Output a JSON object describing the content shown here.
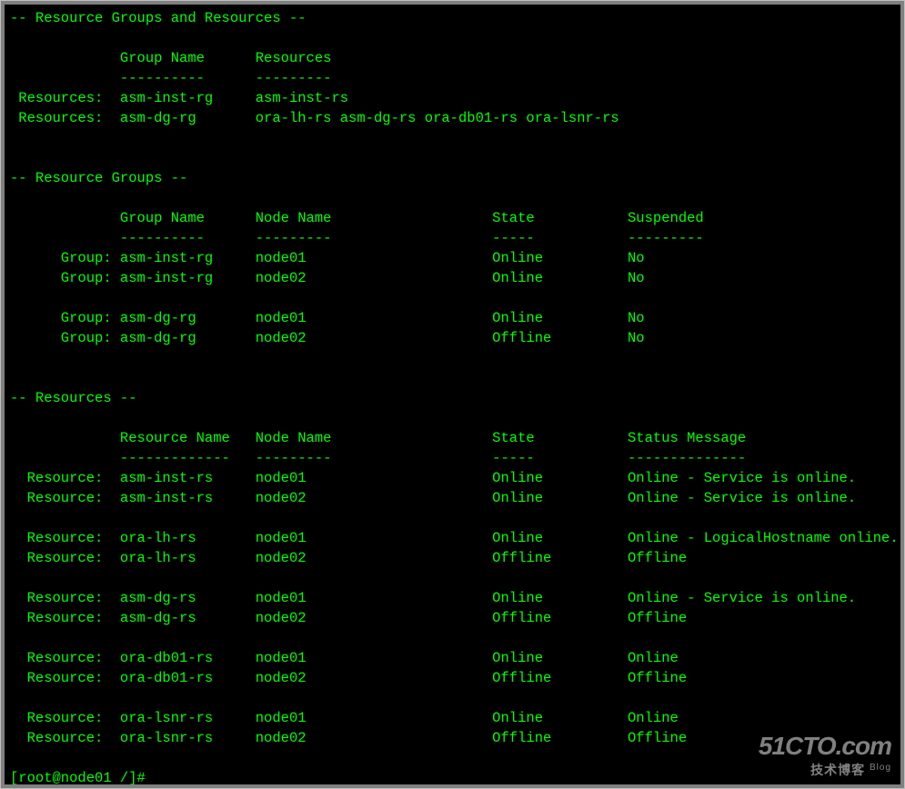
{
  "sections": {
    "rgr": {
      "title": "-- Resource Groups and Resources --",
      "headers": [
        "Group Name",
        "Resources"
      ],
      "rows": [
        {
          "label": "Resources:",
          "group": "asm-inst-rg",
          "resources": "asm-inst-rs"
        },
        {
          "label": "Resources:",
          "group": "asm-dg-rg",
          "resources": "ora-lh-rs asm-dg-rs ora-db01-rs ora-lsnr-rs"
        }
      ]
    },
    "rg": {
      "title": "-- Resource Groups --",
      "headers": [
        "Group Name",
        "Node Name",
        "State",
        "Suspended"
      ],
      "rows": [
        {
          "label": "Group:",
          "group": "asm-inst-rg",
          "node": "node01",
          "state": "Online",
          "suspended": "No"
        },
        {
          "label": "Group:",
          "group": "asm-inst-rg",
          "node": "node02",
          "state": "Online",
          "suspended": "No"
        },
        null,
        {
          "label": "Group:",
          "group": "asm-dg-rg",
          "node": "node01",
          "state": "Online",
          "suspended": "No"
        },
        {
          "label": "Group:",
          "group": "asm-dg-rg",
          "node": "node02",
          "state": "Offline",
          "suspended": "No"
        }
      ]
    },
    "res": {
      "title": "-- Resources --",
      "headers": [
        "Resource Name",
        "Node Name",
        "State",
        "Status Message"
      ],
      "rows": [
        {
          "label": "Resource:",
          "name": "asm-inst-rs",
          "node": "node01",
          "state": "Online",
          "msg": "Online - Service is online."
        },
        {
          "label": "Resource:",
          "name": "asm-inst-rs",
          "node": "node02",
          "state": "Online",
          "msg": "Online - Service is online."
        },
        null,
        {
          "label": "Resource:",
          "name": "ora-lh-rs",
          "node": "node01",
          "state": "Online",
          "msg": "Online - LogicalHostname online."
        },
        {
          "label": "Resource:",
          "name": "ora-lh-rs",
          "node": "node02",
          "state": "Offline",
          "msg": "Offline"
        },
        null,
        {
          "label": "Resource:",
          "name": "asm-dg-rs",
          "node": "node01",
          "state": "Online",
          "msg": "Online - Service is online."
        },
        {
          "label": "Resource:",
          "name": "asm-dg-rs",
          "node": "node02",
          "state": "Offline",
          "msg": "Offline"
        },
        null,
        {
          "label": "Resource:",
          "name": "ora-db01-rs",
          "node": "node01",
          "state": "Online",
          "msg": "Online"
        },
        {
          "label": "Resource:",
          "name": "ora-db01-rs",
          "node": "node02",
          "state": "Offline",
          "msg": "Offline"
        },
        null,
        {
          "label": "Resource:",
          "name": "ora-lsnr-rs",
          "node": "node01",
          "state": "Online",
          "msg": "Online"
        },
        {
          "label": "Resource:",
          "name": "ora-lsnr-rs",
          "node": "node02",
          "state": "Offline",
          "msg": "Offline"
        }
      ]
    }
  },
  "prompt": "[root@node01 /]#",
  "watermark": {
    "brand": "51CTO.com",
    "sub": "技术博客",
    "tag": "Blog"
  }
}
